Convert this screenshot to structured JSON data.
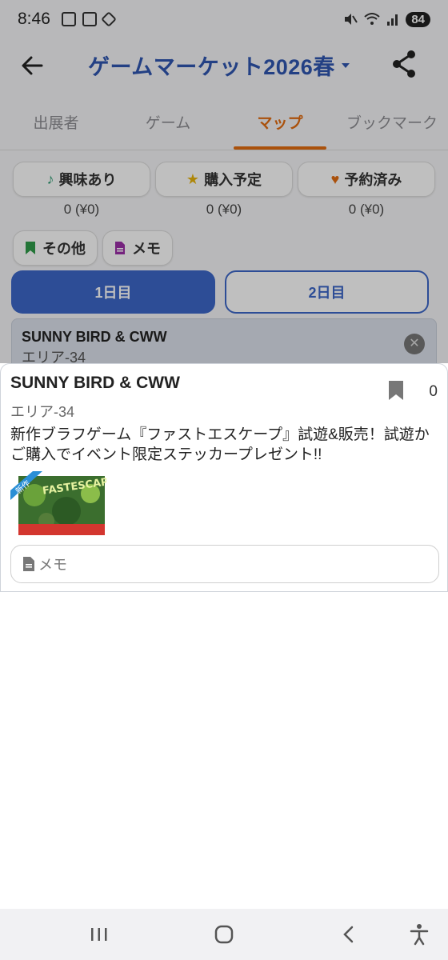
{
  "status": {
    "time": "8:46",
    "battery": "84"
  },
  "header": {
    "title": "ゲームマーケット2026春"
  },
  "tabs": [
    {
      "label": "出展者"
    },
    {
      "label": "ゲーム"
    },
    {
      "label": "マップ"
    },
    {
      "label": "ブックマーク"
    }
  ],
  "active_tab": "マップ",
  "filters": {
    "interested": {
      "label": "興味あり",
      "count": "0 (¥0)"
    },
    "planned": {
      "label": "購入予定",
      "count": "0 (¥0)"
    },
    "reserved": {
      "label": "予約済み",
      "count": "0 (¥0)"
    },
    "other": {
      "label": "その他"
    },
    "memo": {
      "label": "メモ"
    }
  },
  "days": [
    {
      "label": "1日目",
      "active": true
    },
    {
      "label": "2日目",
      "active": false
    }
  ],
  "selected": {
    "name": "SUNNY BIRD & CWW",
    "area": "エリア-34"
  },
  "detail": {
    "name": "SUNNY BIRD & CWW",
    "area": "エリア-34",
    "bookmark_count": "0",
    "description": "新作ブラフゲーム『ファストエスケープ』試遊&販売！試遊かご購入でイベント限定ステッカープレゼント!!",
    "thumb_badge": "新作",
    "thumb_title": "FASTESCAPE",
    "memo_placeholder": "メモ"
  },
  "colors": {
    "accent_orange": "#e36c10",
    "primary_blue": "#3d67c8",
    "title_blue": "#2f56b0"
  }
}
